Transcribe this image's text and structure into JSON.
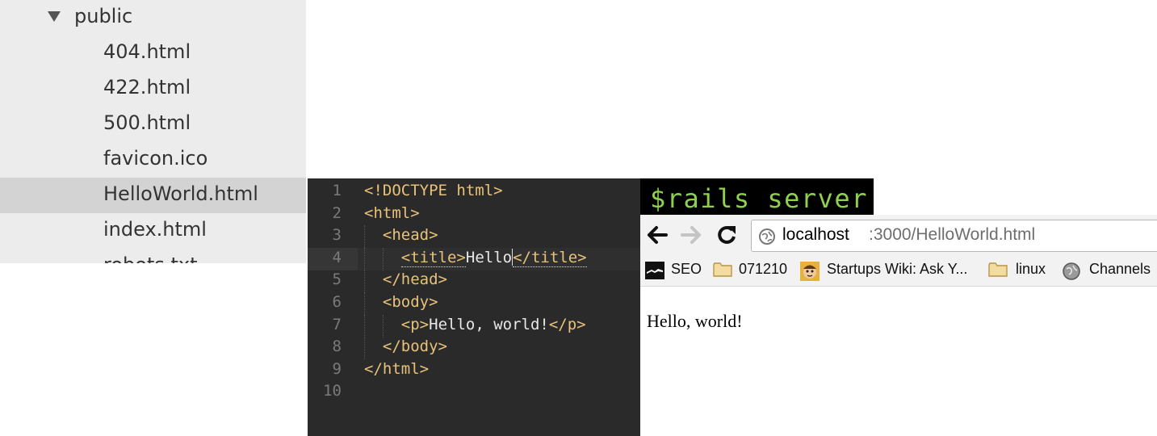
{
  "file_tree": {
    "folder": {
      "name": "public",
      "expanded": true
    },
    "files": [
      {
        "name": "404.html",
        "selected": false
      },
      {
        "name": "422.html",
        "selected": false
      },
      {
        "name": "500.html",
        "selected": false
      },
      {
        "name": "favicon.ico",
        "selected": false
      },
      {
        "name": "HelloWorld.html",
        "selected": true
      },
      {
        "name": "index.html",
        "selected": false
      },
      {
        "name": "robots.txt",
        "selected": false
      }
    ]
  },
  "editor": {
    "active_line": 4,
    "lines": [
      {
        "num": "1",
        "parts": [
          [
            "tag",
            "<!DOCTYPE html>"
          ]
        ]
      },
      {
        "num": "2",
        "parts": [
          [
            "tag",
            "<html>"
          ]
        ]
      },
      {
        "num": "3",
        "parts": [
          [
            "tag",
            "<head>"
          ]
        ]
      },
      {
        "num": "4",
        "parts": [
          [
            "tag",
            "<title>"
          ],
          [
            "txt",
            "Hello"
          ],
          [
            "tag",
            "</title>"
          ]
        ]
      },
      {
        "num": "5",
        "parts": [
          [
            "tag",
            "</head>"
          ]
        ]
      },
      {
        "num": "6",
        "parts": [
          [
            "tag",
            "<body>"
          ]
        ]
      },
      {
        "num": "7",
        "parts": [
          [
            "tag",
            "<p>"
          ],
          [
            "txt",
            "Hello, world!"
          ],
          [
            "tag",
            "</p>"
          ]
        ]
      },
      {
        "num": "8",
        "parts": [
          [
            "tag",
            "</body>"
          ]
        ]
      },
      {
        "num": "9",
        "parts": [
          [
            "tag",
            "</html>"
          ]
        ]
      },
      {
        "num": "10",
        "parts": []
      }
    ]
  },
  "terminal": {
    "command": "$rails server"
  },
  "browser": {
    "url_host": "localhost",
    "url_rest": ":3000/HelloWorld.html",
    "bookmarks": [
      {
        "label": "SEO",
        "icon": "seo-favicon-icon"
      },
      {
        "label": "071210",
        "icon": "folder-icon"
      },
      {
        "label": "Startups Wiki: Ask Y...",
        "icon": "face-favicon-icon"
      },
      {
        "label": "linux",
        "icon": "folder-icon"
      },
      {
        "label": "Channels",
        "icon": "globe-icon"
      }
    ],
    "page_text": "Hello, world!"
  },
  "colors": {
    "editor_bg": "#2a2a2a",
    "tag": "#e8c27a",
    "text": "#e8e8e8",
    "terminal_text": "#8fd14f",
    "sidebar_bg": "#ececec",
    "sidebar_selected": "#d3d3d3"
  }
}
